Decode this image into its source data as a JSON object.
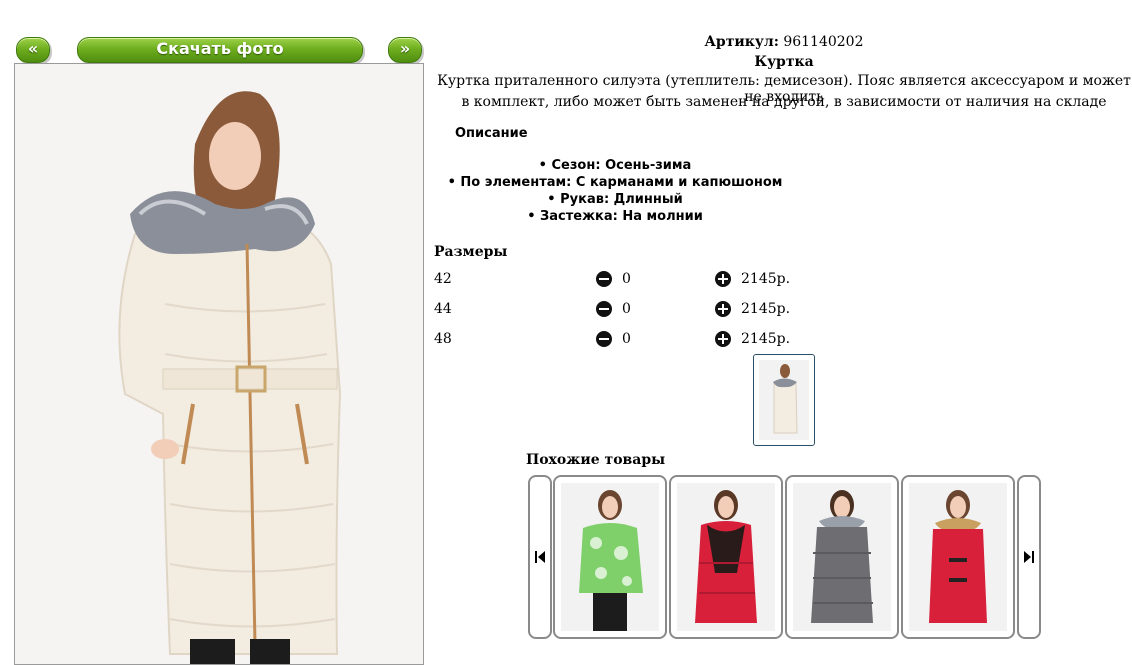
{
  "nav": {
    "prev_label": "«",
    "download_label": "Скачать фото",
    "next_label": "»"
  },
  "product": {
    "article_label": "Артикул:",
    "article_value": "961140202",
    "name": "Куртка",
    "description_line1": "Куртка приталенного силуэта (утеплитель: демисезон). Пояс является аксессуаром и может не входить",
    "description_line2": "в комплект, либо может быть заменен на другой, в зависимости от наличия на складе"
  },
  "details": {
    "heading": "Описание",
    "items": [
      "Сезон: Осень-зима",
      "По элементам: С карманами и капюшоном",
      "Рукав: Длинный",
      "Застежка: На молнии"
    ]
  },
  "sizes": {
    "heading": "Размеры",
    "rows": [
      {
        "size": "42",
        "qty": "0",
        "price": "2145р."
      },
      {
        "size": "44",
        "qty": "0",
        "price": "2145р."
      },
      {
        "size": "48",
        "qty": "0",
        "price": "2145р."
      }
    ]
  },
  "similar": {
    "heading": "Похожие товары"
  },
  "colors": {
    "button_green": "#6fae1f",
    "coat": "#f3ece1",
    "fur": "#8a8f99"
  },
  "icons": [
    "minus-circle-icon",
    "plus-circle-icon",
    "skip-back-icon",
    "skip-forward-icon"
  ]
}
